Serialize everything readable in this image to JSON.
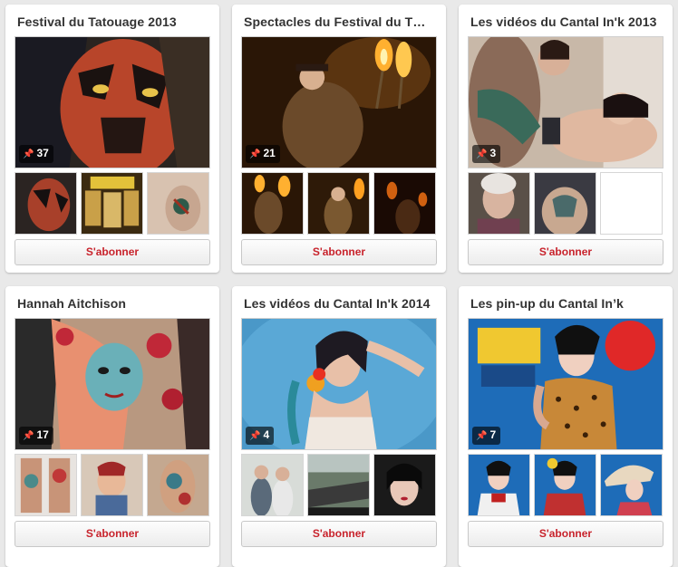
{
  "boards": [
    {
      "title": "Festival du Tatouage 2013",
      "pin_count": "37",
      "follow_label": "S'abonner",
      "cover": "darth-maul-tattoo",
      "thumbs": [
        "tattoo-face",
        "festival-poster",
        "leg-tattoo"
      ]
    },
    {
      "title": "Spectacles du Festival du T…",
      "pin_count": "21",
      "follow_label": "S'abonner",
      "cover": "fire-performer",
      "thumbs": [
        "fire-show-1",
        "fire-show-2",
        "fire-show-3"
      ]
    },
    {
      "title": "Les vidéos du Cantal In'k 2013",
      "pin_count": "3",
      "follow_label": "S'abonner",
      "cover": "tattoo-session",
      "thumbs": [
        "elderly-woman",
        "chest-tattoo",
        "empty"
      ]
    },
    {
      "title": "Hannah Aitchison",
      "pin_count": "17",
      "follow_label": "S'abonner",
      "cover": "zombie-pinup-tattoo",
      "thumbs": [
        "leg-tattoos",
        "pinup-girl",
        "arm-tattoo"
      ]
    },
    {
      "title": "Les vidéos du Cantal In'k 2014",
      "pin_count": "4",
      "follow_label": "S'abonner",
      "cover": "pinup-blue-background",
      "thumbs": [
        "couple",
        "street",
        "dark-hair-woman"
      ]
    },
    {
      "title": "Les pin-up du Cantal In’k",
      "pin_count": "7",
      "follow_label": "S'abonner",
      "cover": "pinup-leopard-dress",
      "thumbs": [
        "pinup-sailor",
        "pinup-red",
        "pinup-umbrella"
      ]
    }
  ],
  "pin_icon": "pin-icon",
  "colors": {
    "follow_text": "#c8232c",
    "background": "#e9e9e9",
    "title": "#333333"
  }
}
